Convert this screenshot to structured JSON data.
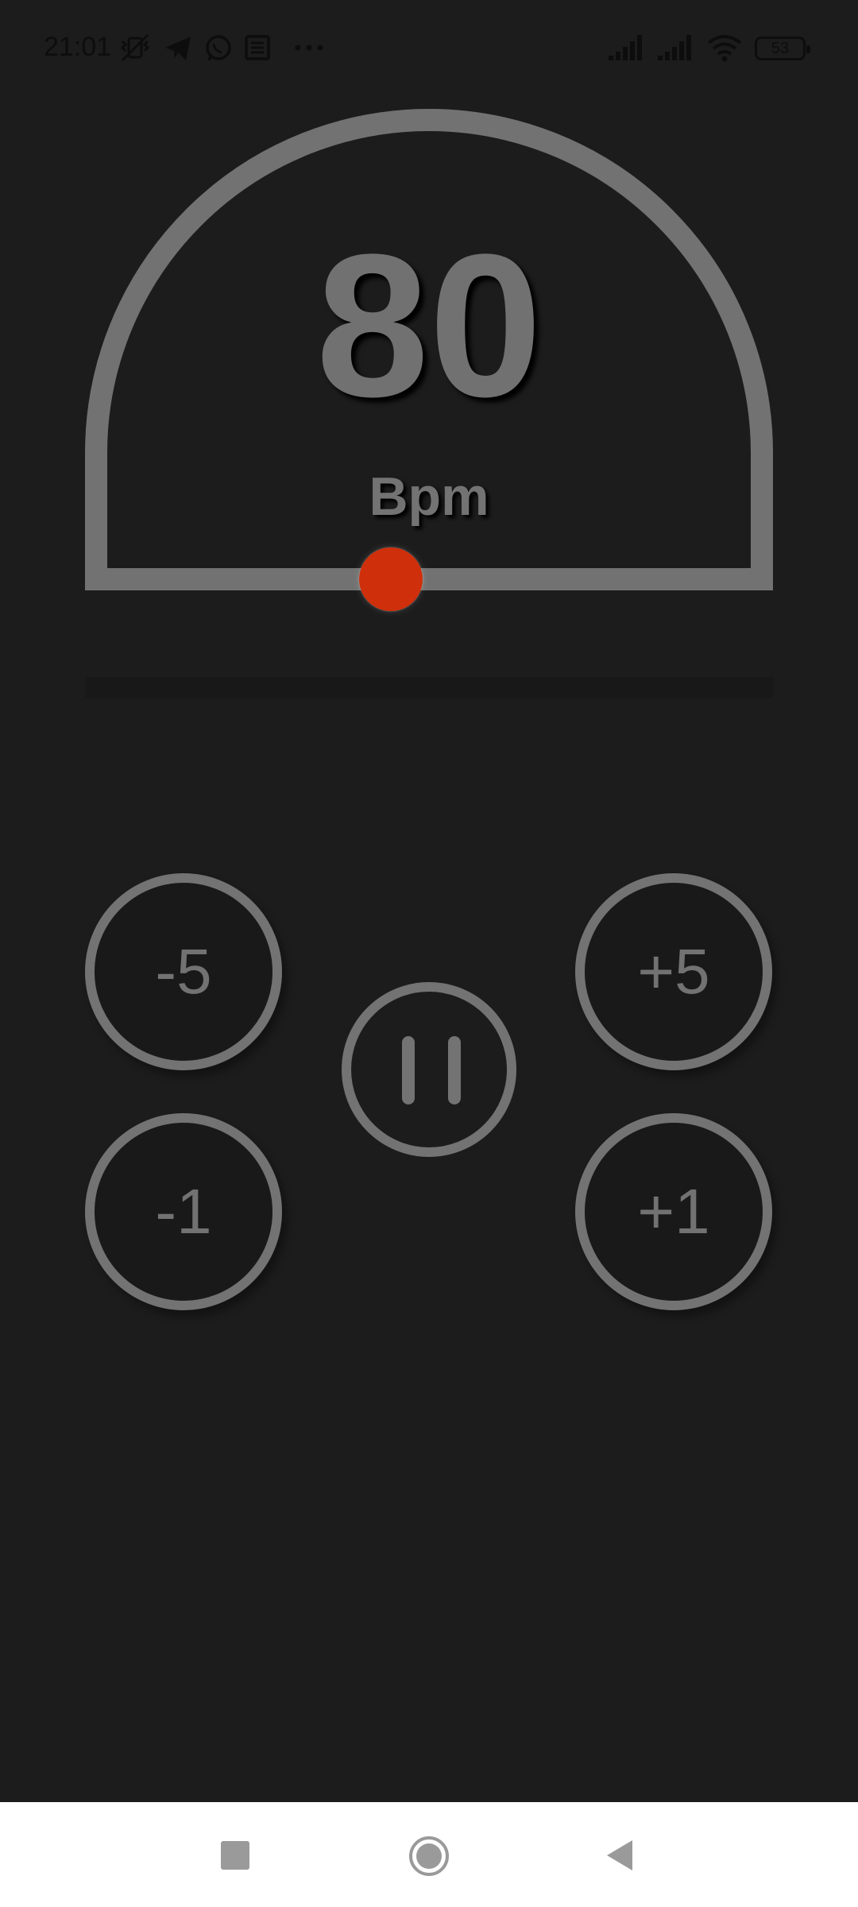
{
  "status_bar": {
    "time": "21:01",
    "battery_level": "53",
    "icons": [
      "mute-vibrate-icon",
      "telegram-icon",
      "whatsapp-icon",
      "news-icon",
      "more-dots-icon",
      "signal-icon",
      "signal-icon",
      "wifi-icon",
      "battery-icon"
    ]
  },
  "metronome": {
    "bpm": "80",
    "unit": "Bpm",
    "dial_color": "#727272",
    "knob_color": "#cf2f0a"
  },
  "controls": {
    "minus5": "-5",
    "plus5": "+5",
    "minus1": "-1",
    "plus1": "+1",
    "play_pause_icon": "pause-icon"
  },
  "nav_bar": {
    "recent_icon": "recent-apps-icon",
    "home_icon": "home-icon",
    "back_icon": "back-icon"
  }
}
